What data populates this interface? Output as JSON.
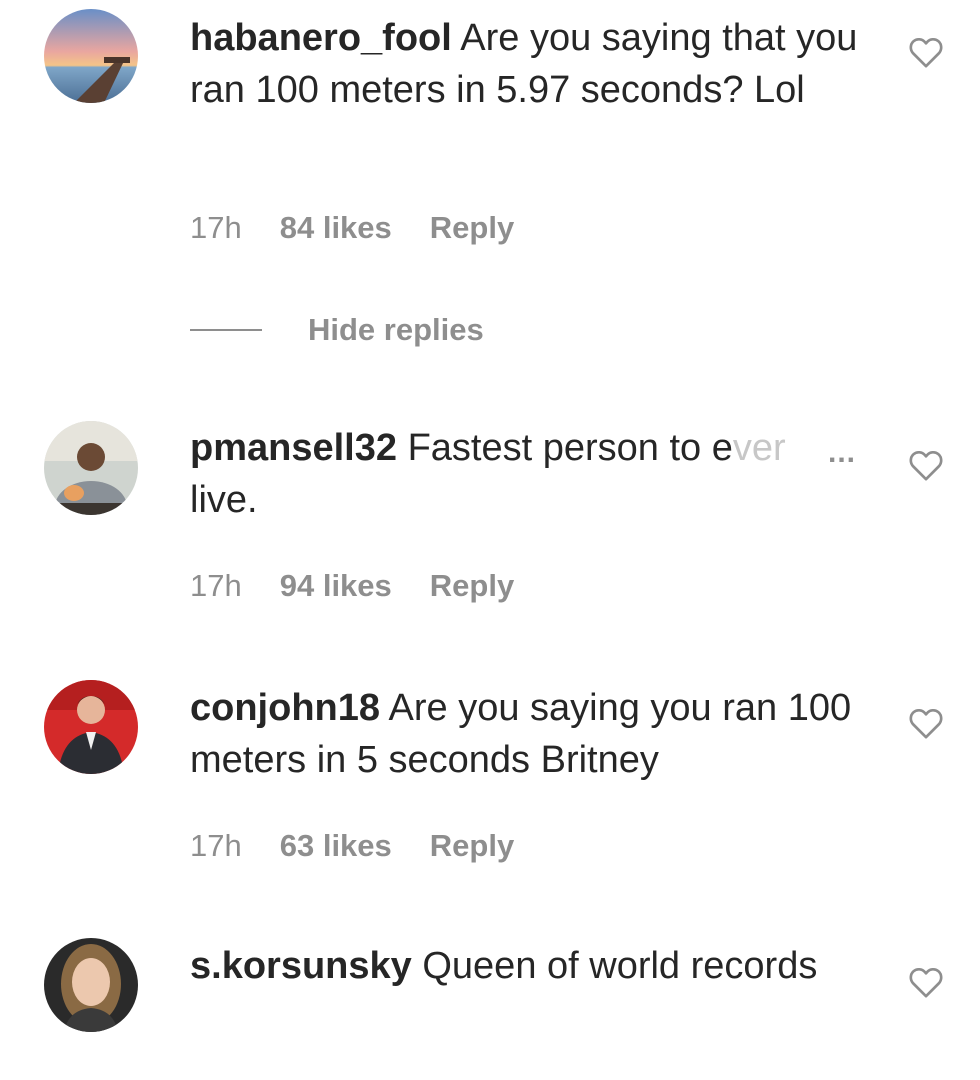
{
  "comments": [
    {
      "username": "habanero_fool",
      "text": "Are you saying that you ran 100 meters in 5.97 seconds? Lol",
      "time": "17h",
      "likes": "84 likes",
      "reply": "Reply"
    },
    {
      "username": "pmansell32",
      "text_visible": "Fastest person to e",
      "text_faded": "ver",
      "text_after": "live.",
      "more": "...",
      "time": "17h",
      "likes": "94 likes",
      "reply": "Reply"
    },
    {
      "username": "conjohn18",
      "text": "Are you saying you ran 100 meters in 5 seconds Britney",
      "time": "17h",
      "likes": "63 likes",
      "reply": "Reply"
    },
    {
      "username": "s.korsunsky",
      "text": "Queen of world records"
    }
  ],
  "hide_replies": "Hide replies",
  "icons": {
    "like": "heart-outline-icon"
  },
  "colors": {
    "text": "#262626",
    "secondary": "#8e8e8e",
    "faded": "#c7c7c7",
    "background": "#ffffff"
  }
}
